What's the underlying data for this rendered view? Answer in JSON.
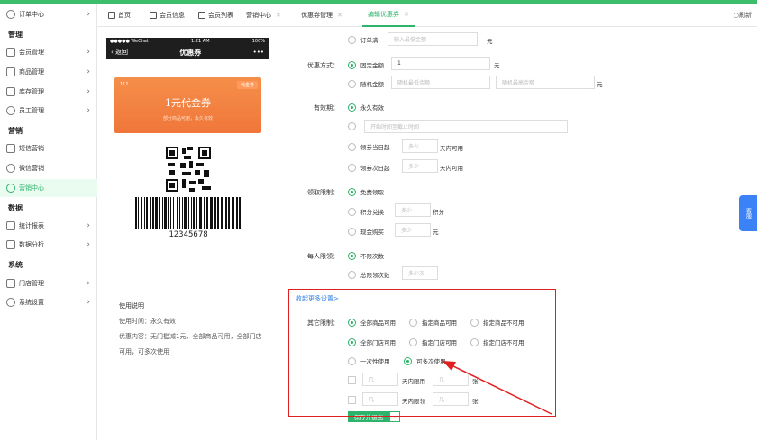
{
  "sidebar": {
    "items": [
      {
        "label": "订单中心"
      },
      {
        "label": "会员管理"
      },
      {
        "label": "商品管理"
      },
      {
        "label": "库存管理"
      },
      {
        "label": "员工管理"
      },
      {
        "label": "短信营销"
      },
      {
        "label": "微信营销"
      },
      {
        "label": "营销中心"
      },
      {
        "label": "统计报表"
      },
      {
        "label": "数据分析"
      },
      {
        "label": "门店管理"
      },
      {
        "label": "系统设置"
      }
    ],
    "headers": [
      "管理",
      "营销",
      "数据",
      "系统"
    ]
  },
  "tabs": [
    {
      "label": "首页"
    },
    {
      "label": "会员信息"
    },
    {
      "label": "会员列表"
    },
    {
      "label": "营销中心"
    },
    {
      "label": "优惠券管理"
    },
    {
      "label": "编辑优惠券"
    }
  ],
  "refresh_label": "刷新",
  "phone": {
    "carrier": "●●●●● WeChat",
    "time": "1:21 AM",
    "battery": "100%",
    "back": "返回",
    "title": "优惠券",
    "more": "•••",
    "coupon_num": "111",
    "coupon_tag": "代金券",
    "coupon_title": "1元代金券",
    "coupon_sub": "部分商品可用，永久有效",
    "barcode_number": "12345678",
    "usage_title": "使用说明",
    "usage_time": "使用时间：永久有效",
    "usage_content": "优惠内容：无门槛减1元，全部商品可用，全部门店可用，可多次使用"
  },
  "form": {
    "top_partial": {
      "option": "订单满",
      "placeholder": "输入最低金额",
      "unit": "元"
    },
    "discount": {
      "label": "优惠方式：",
      "fixed": "固定金额",
      "fixed_value": "1",
      "unit": "元",
      "random": "随机金额",
      "random_min_ph": "随机最低金额",
      "random_max_ph": "随机最高金额"
    },
    "validity": {
      "label": "有效期：",
      "forever": "永久有效",
      "range_ph": "开始时间至截止时间",
      "same_day": "领券当日起",
      "same_day_ph": "多少",
      "same_day_unit": "天内可用",
      "next_day": "领券次日起",
      "next_day_ph": "多少",
      "next_day_unit": "天内可用"
    },
    "claim": {
      "label": "领取限制：",
      "free": "免费领取",
      "points": "积分兑换",
      "points_ph": "多少",
      "points_unit": "积分",
      "cash": "现金购买",
      "cash_ph": "多少",
      "cash_unit": "元"
    },
    "per_person": {
      "label": "每人限领：",
      "unlimited": "不限次数",
      "total": "总限领次数",
      "total_ph": "多少次"
    },
    "more_link": "收起更多设置>",
    "other": {
      "label": "其它限制：",
      "goods_all": "全部商品可用",
      "goods_spec": "指定商品可用",
      "goods_not": "指定商品不可用",
      "store_all": "全部门店可用",
      "store_spec": "指定门店可用",
      "store_not": "指定门店不可用",
      "once": "一次性使用",
      "multi": "可多次使用",
      "ph_ji": "几",
      "day_use": "天内限用",
      "day_claim": "天内限领",
      "zhang": "张"
    },
    "save_button": "保存并退出"
  },
  "sidebtn_label": "客服"
}
